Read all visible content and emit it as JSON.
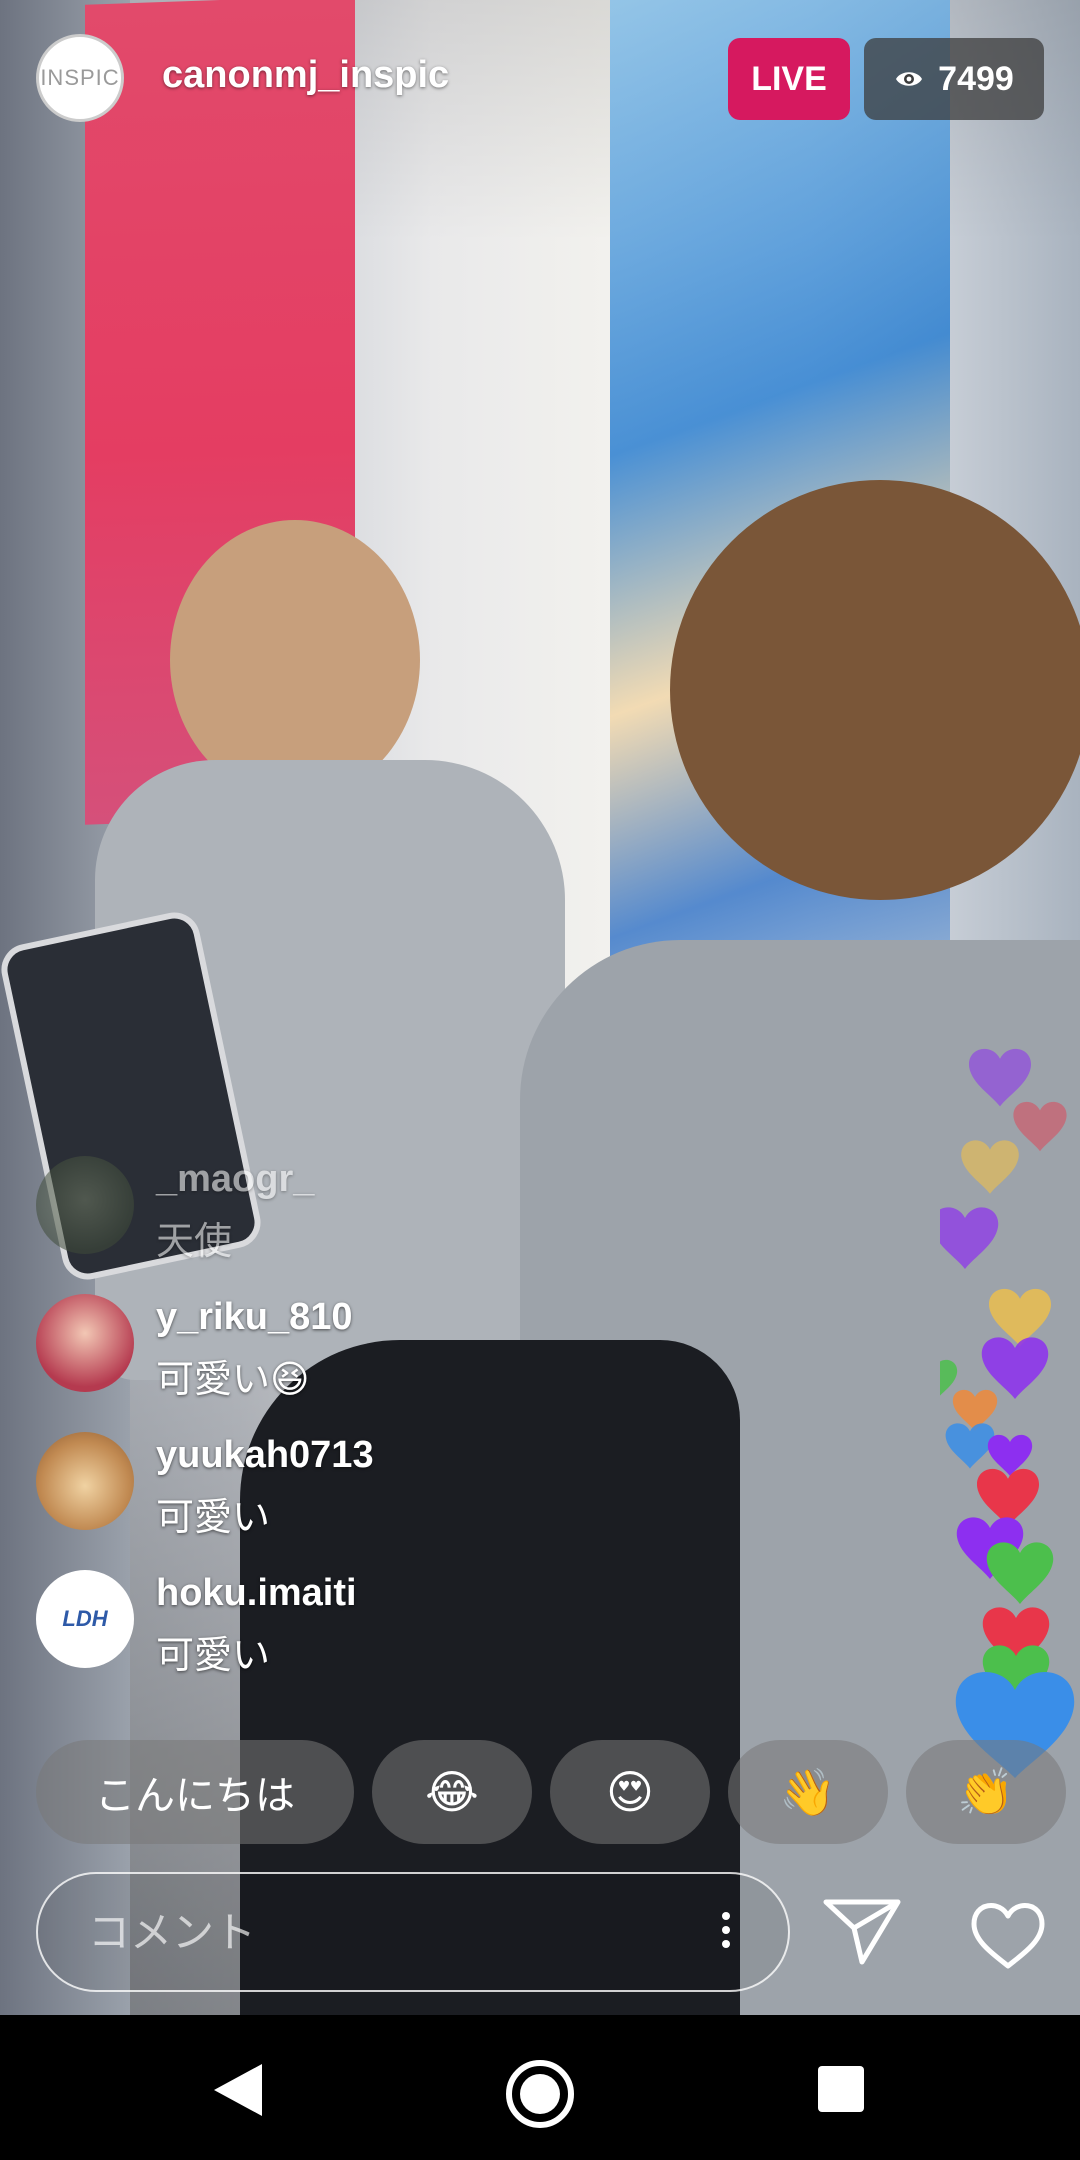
{
  "header": {
    "avatar_text": "INSPIC",
    "username": "canonmj_inspic",
    "live_label": "LIVE",
    "viewer_count": "7499"
  },
  "comments": [
    {
      "user": "_maogr_",
      "text": "天使",
      "faded": true
    },
    {
      "user": "y_riku_810",
      "text": "可愛い😆",
      "faded": false
    },
    {
      "user": "yuukah0713",
      "text": "可愛い",
      "faded": false
    },
    {
      "user": "hoku.imaiti",
      "text": "可愛い",
      "faded": false,
      "avatar_text": "LDH"
    }
  ],
  "quick_replies": [
    {
      "label": "こんにちは"
    },
    {
      "label": "😂"
    },
    {
      "label": "😍"
    },
    {
      "label": "👋"
    },
    {
      "label": "👏"
    }
  ],
  "composer": {
    "placeholder": "コメント"
  },
  "colors": {
    "live": "#d6195f",
    "viewer_badge": "#3c3c3c",
    "hearts": [
      "#8d2ff0",
      "#e8364a",
      "#4cbf4c",
      "#f5c242",
      "#3a8ee8",
      "#f08a3a"
    ]
  }
}
